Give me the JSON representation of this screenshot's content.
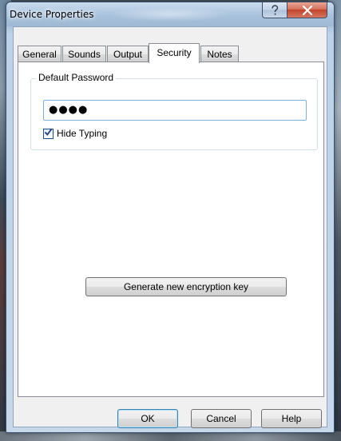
{
  "window": {
    "title": "Device Properties"
  },
  "title_buttons": {
    "help_glyph": "?",
    "close_glyph": "✕"
  },
  "tabs": [
    {
      "label": "General"
    },
    {
      "label": "Sounds"
    },
    {
      "label": "Output"
    },
    {
      "label": "Security",
      "active": true
    },
    {
      "label": "Notes"
    }
  ],
  "security": {
    "group_label": "Default Password",
    "password_value": "●●●●",
    "hide_typing_label": "Hide Typing",
    "hide_typing_checked": true,
    "generate_key_label": "Generate new encryption key"
  },
  "footer": {
    "ok_label": "OK",
    "cancel_label": "Cancel",
    "help_label": "Help"
  },
  "icons": {
    "help": "question-mark-icon",
    "close": "close-icon",
    "check": "checkmark-icon"
  },
  "colors": {
    "title_bar": "#a8c2dc",
    "close_button": "#c2432a",
    "input_border": "#7fb0d6",
    "default_button_border": "#3c7fb1"
  }
}
